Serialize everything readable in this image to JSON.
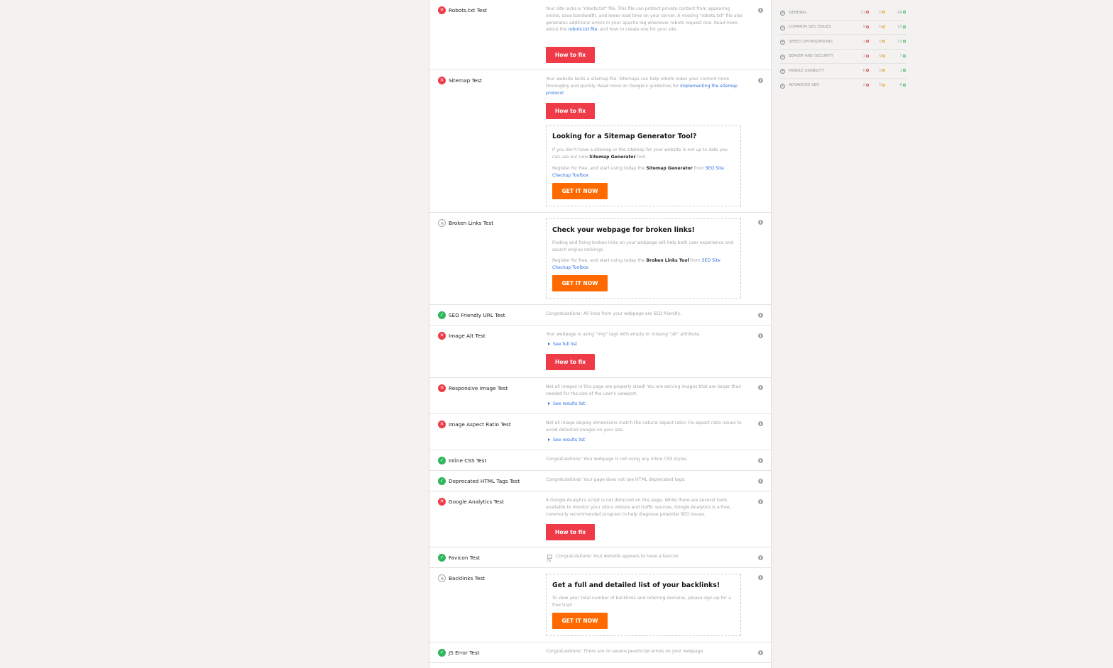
{
  "tests": {
    "robots": {
      "name": "Robots.txt Test",
      "desc_a": "Your site lacks a \"robots.txt\" file. This file can protect private content from appearing online, save bandwidth, and lower load time on your server. A missing \"robots.txt\" file also generates additional errors in your apache log whenever robots request one. Read more about the ",
      "link": "robots.txt file",
      "desc_b": ", and how to create one for your site.",
      "fix": "How to fix"
    },
    "sitemap": {
      "name": "Sitemap Test",
      "desc_a": "Your website lacks a sitemap file. Sitemaps can help robots index your content more thoroughly and quickly. Read more on Google's guidelines for ",
      "link": "implementing the sitemap protocol",
      "desc_b": ".",
      "fix": "How to fix",
      "promo": {
        "title": "Looking for a Sitemap Generator Tool?",
        "p1_a": "If you don't have a sitemap or the sitemap for your website is not up to date you can use our new ",
        "p1_b": "Sitemap Generator",
        "p1_c": " tool.",
        "p2_a": "Register for free, and start using today the ",
        "p2_b": "Sitemap Generator",
        "p2_c": " from ",
        "p2_link": "SEO Site Checkup Toolbox",
        "p2_d": ".",
        "cta": "GET IT NOW"
      }
    },
    "broken": {
      "name": "Broken Links Test",
      "promo": {
        "title": "Check your webpage for broken links!",
        "p1": "Finding and fixing broken links on your webpage will help both user experience and search engine rankings.",
        "p2_a": "Register for free, and start using today the ",
        "p2_b": "Broken Links Tool",
        "p2_c": " from  ",
        "p2_link": "SEO Site Checkup Toolbox",
        "cta": "GET IT NOW"
      }
    },
    "seo_url": {
      "name": "SEO Friendly URL Test",
      "desc": "Congratulations! All links from your webpage are SEO friendly."
    },
    "img_alt": {
      "name": "Image Alt Test",
      "desc": "Your webpage is using \"img\" tags with empty or missing \"alt\" attribute.",
      "see": "See full list",
      "fix": "How to fix"
    },
    "responsive": {
      "name": "Responsive Image Test",
      "desc": "Not all images in this page are properly sized! You are serving images that are larger than needed for the size of the user's viewport.",
      "see": "See results list"
    },
    "aspect": {
      "name": "Image Aspect Ratio Test",
      "desc": "Not all image display dimensions match the natural aspect ratio! Fix aspect ratio issues to avoid distorted images on your site.",
      "see": "See results list"
    },
    "inline_css": {
      "name": "Inline CSS Test",
      "desc": "Congratulations! Your webpage is not using any inline CSS styles."
    },
    "deprecated": {
      "name": "Deprecated HTML Tags Test",
      "desc": "Congratulations! Your page does not use HTML deprecated tags."
    },
    "analytics": {
      "name": "Google Analytics Test",
      "desc": "A Google Analytics script is not detected on this page. While there are several tools available to monitor your site's visitors and traffic sources, Google Analytics is a free, commonly recommended program to help diagnose potential SEO issues.",
      "fix": "How to fix"
    },
    "favicon": {
      "name": "Favicon Test",
      "alt": "fa",
      "desc": "Congratulations! Your website appears to have a favicon."
    },
    "backlinks": {
      "name": "Backlinks Test",
      "promo": {
        "title": "Get a full and detailed list of your backlinks!",
        "p1": "To view your total number of backlinks and referring domains, please sign-up for a free trial!",
        "cta": "GET IT NOW"
      }
    },
    "js_error": {
      "name": "JS Error Test",
      "desc": "Congratulations! There are no severe JavaScript errors on your webpage."
    }
  },
  "info_glyph": "i",
  "sidebar": {
    "categories": [
      {
        "label": "GENERAL",
        "failed": "13",
        "warnings": "0",
        "passed": "46"
      },
      {
        "label": "COMMON SEO ISSUES",
        "failed": "9",
        "warnings": "0",
        "passed": "15"
      },
      {
        "label": "SPEED OPTIMIZATIONS",
        "failed": "1",
        "warnings": "0",
        "passed": "15"
      },
      {
        "label": "SERVER AND SECURITY",
        "failed": "1",
        "warnings": "0",
        "passed": "7"
      },
      {
        "label": "MOBILE USABILITY",
        "failed": "0",
        "warnings": "0",
        "passed": "3"
      },
      {
        "label": "ADVANCED SEO",
        "failed": "2",
        "warnings": "0",
        "passed": "6"
      }
    ]
  },
  "colors": {
    "fail": "#ee3b47",
    "pass": "#2fb55a",
    "warning": "#f2a516",
    "cta": "#ff6a00",
    "link": "#2c6fe0"
  }
}
